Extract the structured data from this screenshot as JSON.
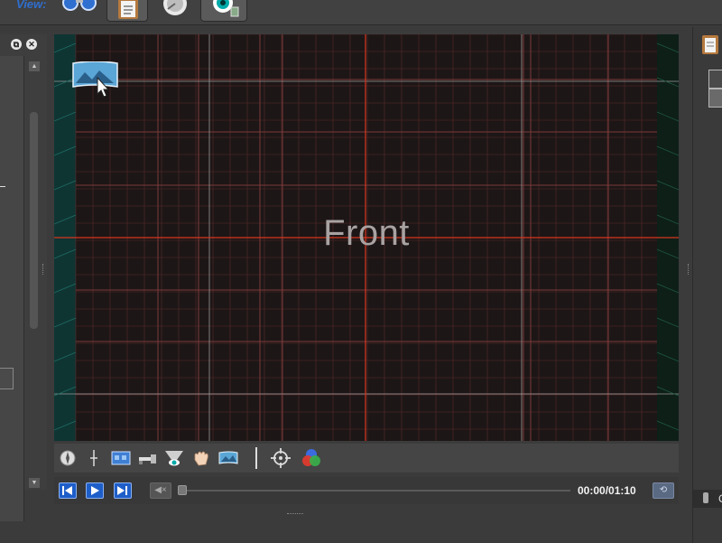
{
  "toolbar": {
    "view_label": "View:",
    "buttons": [
      {
        "icon": "binoculars-icon"
      },
      {
        "icon": "clipboard-icon"
      },
      {
        "icon": "dial-icon"
      },
      {
        "icon": "eye-settings-icon"
      }
    ]
  },
  "left_panel": {
    "detach_icon": "detach-icon",
    "close_icon": "close-icon",
    "detach_glyph": "⧉",
    "close_glyph": "✕",
    "scroll_up": "▲",
    "scroll_down": "▼"
  },
  "viewport": {
    "view_name": "Front",
    "background": "#1d1616",
    "grid_color": "#5a2a2a",
    "axis_color": "#d8361f",
    "guide_color": "#9a9a9a",
    "side_color": "#0f3533"
  },
  "tools": [
    {
      "icon": "compass-icon"
    },
    {
      "icon": "crosshair-line-icon"
    },
    {
      "icon": "film-strip-icon"
    },
    {
      "icon": "dolly-icon"
    },
    {
      "icon": "eye-cone-icon"
    },
    {
      "icon": "hand-icon"
    },
    {
      "icon": "panorama-icon"
    },
    {
      "icon": "target-icon"
    },
    {
      "icon": "color-wheel-icon"
    }
  ],
  "timeline": {
    "time": "00:00/01:10",
    "mute_glyph": "◀×",
    "end_glyph": "⟲",
    "progress": 0
  },
  "right_panel": {
    "bottom_label": "C"
  }
}
